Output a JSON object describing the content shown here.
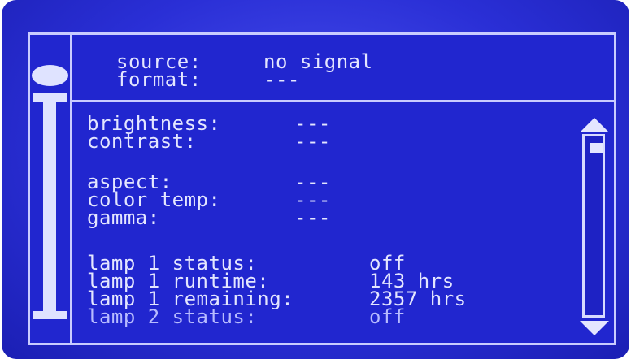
{
  "header": {
    "rows": [
      {
        "label": "source:",
        "value": "no signal"
      },
      {
        "label": "format:",
        "value": "---"
      }
    ]
  },
  "picture": {
    "rows": [
      {
        "label": "brightness:",
        "value": "---"
      },
      {
        "label": "contrast:",
        "value": "---"
      }
    ]
  },
  "display": {
    "rows": [
      {
        "label": "aspect:",
        "value": "---"
      },
      {
        "label": "color temp:",
        "value": "---"
      },
      {
        "label": "gamma:",
        "value": "---"
      }
    ]
  },
  "lamps": {
    "rows": [
      {
        "label": "lamp 1 status:",
        "value": "off"
      },
      {
        "label": "lamp 1 runtime:",
        "value": "143 hrs"
      },
      {
        "label": "lamp 1 remaining:",
        "value": "2357 hrs"
      },
      {
        "label": "lamp 2 status:",
        "value": "off"
      }
    ]
  },
  "colors": {
    "background": "#2126cf",
    "text": "#e4e6ff",
    "border": "#c9ccff"
  },
  "icons": {
    "scroll_up": "up-arrow-icon",
    "scroll_down": "down-arrow-icon",
    "slider": "slider-knob-icon"
  }
}
